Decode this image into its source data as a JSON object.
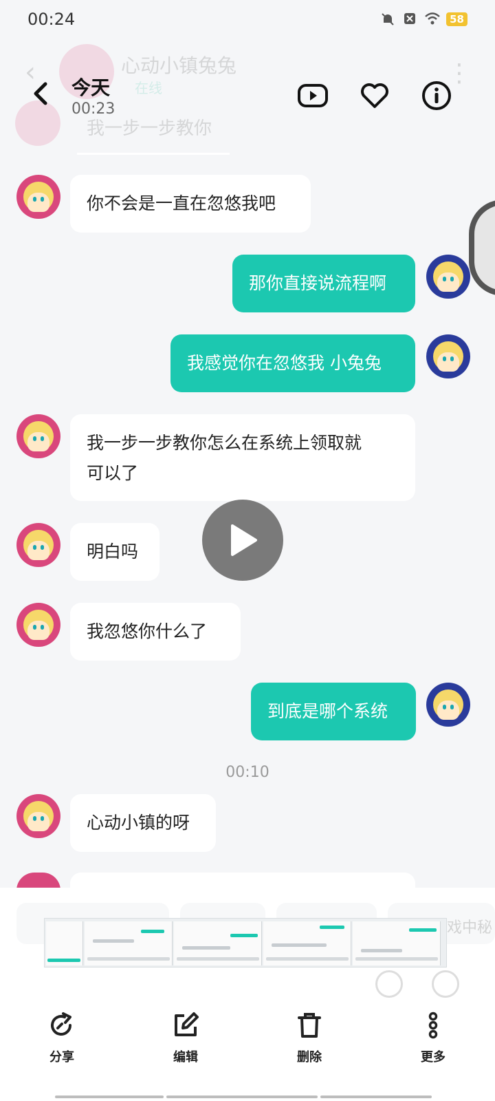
{
  "status_bar": {
    "time": "00:24",
    "battery": "58"
  },
  "background_header": {
    "contact_name": "心动小镇兔兔",
    "contact_status": "在线",
    "preview_message": "我一步一步教你"
  },
  "header": {
    "title": "今天",
    "subtitle": "00:23"
  },
  "messages": [
    {
      "side": "in",
      "text": "你不会是一直在忽悠我吧"
    },
    {
      "side": "out",
      "text": "那你直接说流程啊"
    },
    {
      "side": "out",
      "text": "我感觉你在忽悠我 小兔兔"
    },
    {
      "side": "in",
      "text": "我一步一步教你怎么在系统上领取就\n可以了"
    },
    {
      "side": "in",
      "text": "明白吗"
    },
    {
      "side": "in",
      "text": "我忽悠你什么了"
    },
    {
      "side": "out",
      "text": "到底是哪个系统"
    },
    {
      "side": "time",
      "text": "00:10"
    },
    {
      "side": "in",
      "text": "心动小镇的呀"
    }
  ],
  "strip_tail_text": "戏中秘",
  "actions": [
    {
      "label": "分享",
      "icon": "share-icon"
    },
    {
      "label": "编辑",
      "icon": "edit-icon"
    },
    {
      "label": "删除",
      "icon": "trash-icon"
    },
    {
      "label": "更多",
      "icon": "more-vertical-icon"
    }
  ],
  "colors": {
    "outgoing_bubble": "#1cc8b0",
    "incoming_bubble": "#ffffff",
    "background": "#f5f6f8"
  }
}
